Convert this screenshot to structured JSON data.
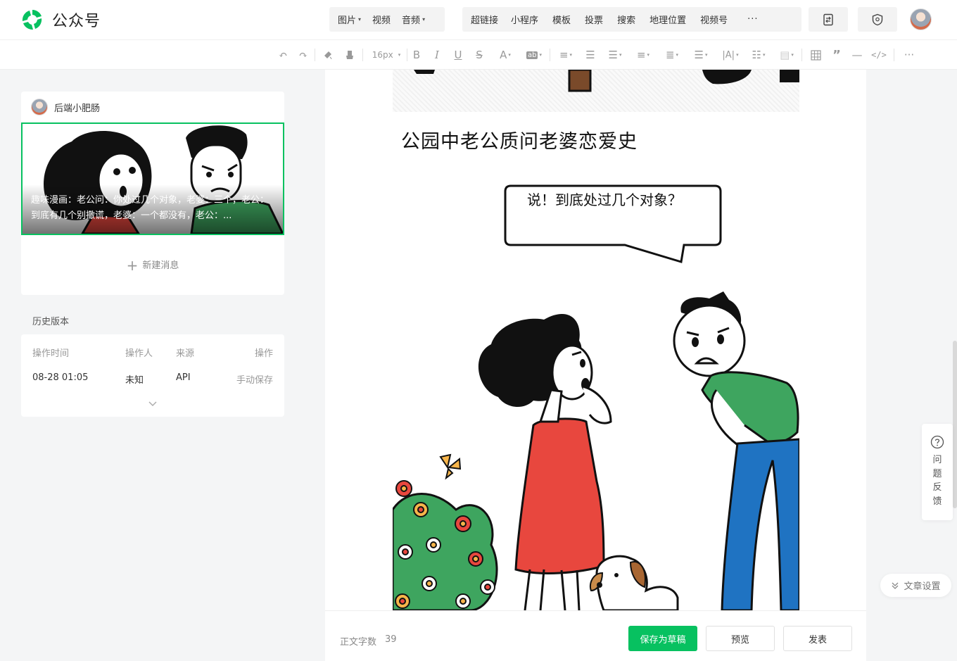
{
  "app": {
    "title": "公众号"
  },
  "insert_toolbar": {
    "media": [
      {
        "label": "图片",
        "dropdown": true
      },
      {
        "label": "视频",
        "dropdown": false
      },
      {
        "label": "音频",
        "dropdown": true
      }
    ],
    "widgets": [
      "超链接",
      "小程序",
      "模板",
      "投票",
      "搜索",
      "地理位置",
      "视频号"
    ],
    "more": "···"
  },
  "format_toolbar": {
    "font_size": "16px"
  },
  "messages": {
    "author": "后端小肥肠",
    "cover_title": "趣味漫画：老公问：你处过几个对象，老婆：三个，老公：到底有几个别撒谎，老婆：一个都没有，老公：...",
    "new_message": "新建消息"
  },
  "history": {
    "label": "历史版本",
    "headers": {
      "time": "操作时间",
      "operator": "操作人",
      "source": "来源",
      "action": "操作"
    },
    "rows": [
      {
        "time": "08-28 01:05",
        "operator": "未知",
        "source": "API",
        "action": "手动保存"
      }
    ]
  },
  "article": {
    "title": "公园中老公质问老婆恋爱史",
    "speech": "说！到底处过几个对象？"
  },
  "footer": {
    "word_count_label": "正文字数",
    "word_count": "39",
    "save_draft": "保存为草稿",
    "preview": "预览",
    "publish": "发表"
  },
  "side": {
    "feedback_chars": [
      "问",
      "题",
      "反",
      "馈"
    ],
    "article_settings": "文章设置"
  },
  "colors": {
    "brand": "#07c160",
    "shirt_green": "#3ea55f",
    "dress_red": "#e8473e",
    "jeans_blue": "#1f73c2"
  },
  "icons": [
    "logo-icon",
    "document-swap-icon",
    "shield-icon",
    "undo-icon",
    "redo-icon",
    "paint-format-icon",
    "eraser-icon",
    "bold-icon",
    "italic-icon",
    "underline-icon",
    "strikethrough-icon",
    "font-color-icon",
    "background-color-icon",
    "align-icon",
    "indent-icon",
    "line-height-icon",
    "list-icon",
    "table-icon",
    "quote-icon",
    "divider-icon",
    "code-icon",
    "help-icon",
    "chevron-down-icon",
    "double-chevron-down-icon"
  ]
}
